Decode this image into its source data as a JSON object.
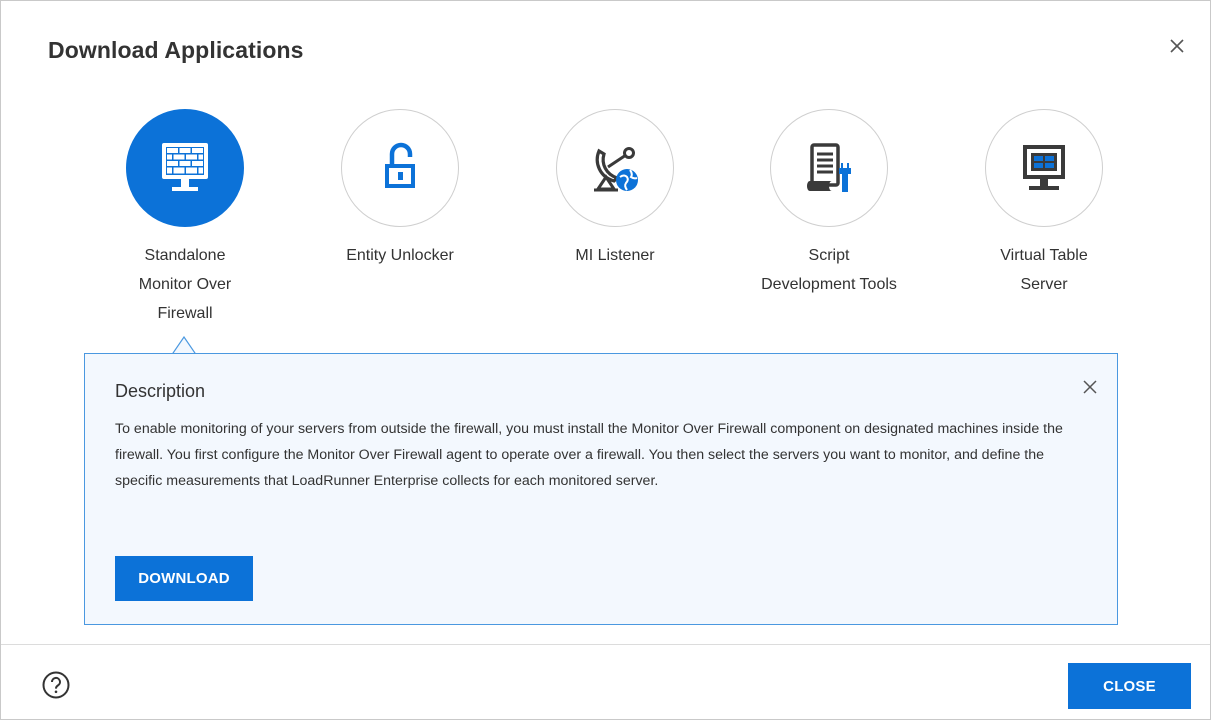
{
  "dialog": {
    "title": "Download Applications",
    "close_icon": "close-icon"
  },
  "apps": [
    {
      "label": "Standalone Monitor Over Firewall",
      "icon": "firewall-monitor-icon",
      "selected": true
    },
    {
      "label": "Entity Unlocker",
      "icon": "unlock-icon",
      "selected": false
    },
    {
      "label": "MI Listener",
      "icon": "satellite-dish-icon",
      "selected": false
    },
    {
      "label": "Script Development Tools",
      "icon": "script-tools-icon",
      "selected": false
    },
    {
      "label": "Virtual Table Server",
      "icon": "virtual-table-monitor-icon",
      "selected": false
    }
  ],
  "description": {
    "title": "Description",
    "text": "To enable monitoring of your servers from outside the firewall, you must install the Monitor Over Firewall component on designated machines inside the firewall. You first configure the Monitor Over Firewall agent to operate over a firewall. You then select the servers you want to monitor, and define the specific measurements that LoadRunner Enterprise collects for each monitored server.",
    "download_label": "DOWNLOAD"
  },
  "footer": {
    "help_icon": "help-icon",
    "close_label": "CLOSE"
  },
  "colors": {
    "accent": "#0c72d8",
    "panel_bg": "#f3f8fe",
    "panel_border": "#4a98e0",
    "icon_dark": "#3a3a3a"
  }
}
